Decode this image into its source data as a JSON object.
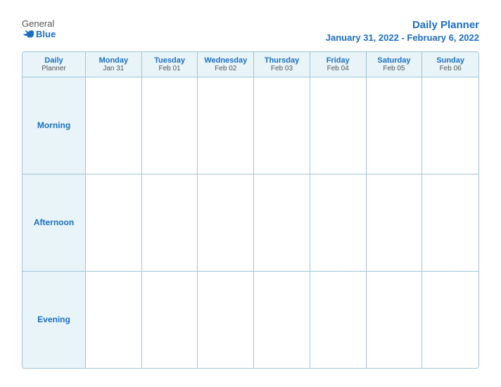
{
  "header": {
    "logo_general": "General",
    "logo_blue": "Blue",
    "title": "Daily Planner",
    "date_range": "January 31, 2022 - February 6, 2022"
  },
  "calendar": {
    "first_col": {
      "line1": "Daily",
      "line2": "Planner"
    },
    "days": [
      {
        "name": "Monday",
        "date": "Jan 31"
      },
      {
        "name": "Tuesday",
        "date": "Feb 01"
      },
      {
        "name": "Wednesday",
        "date": "Feb 02"
      },
      {
        "name": "Thursday",
        "date": "Feb 03"
      },
      {
        "name": "Friday",
        "date": "Feb 04"
      },
      {
        "name": "Saturday",
        "date": "Feb 05"
      },
      {
        "name": "Sunday",
        "date": "Feb 06"
      }
    ],
    "periods": [
      {
        "label": "Morning"
      },
      {
        "label": "Afternoon"
      },
      {
        "label": "Evening"
      }
    ]
  },
  "colors": {
    "accent": "#1a6fc4",
    "header_bg": "#e8f4f8",
    "border": "#a0c4d8"
  }
}
